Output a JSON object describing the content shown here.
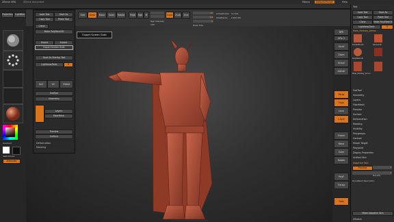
{
  "titlebar": {
    "app": "ZBrush 4R8",
    "document": "ZBrush document",
    "items": [
      "Menus",
      "DefaultZScript",
      "Help"
    ]
  },
  "menubar": [
    "Alpha",
    "Brush",
    "Color",
    "Document",
    "Draw",
    "Edit",
    "File",
    "Layer",
    "Light",
    "Macro",
    "Marker",
    "Material",
    "Movie",
    "Picker",
    "Preferences",
    "Render",
    "Stencil",
    "Stroke",
    "Texture",
    "Tool",
    "Transform",
    "Zplugin",
    "Zscript"
  ],
  "topshelf": {
    "edit_label": "Edit",
    "draw_label": "Draw",
    "move_label": "Move",
    "scale_label": "Scale",
    "rotate_label": "Rotate",
    "mrgb_label": "Mrgb",
    "rgb_label": "Rgb",
    "m_label": "M",
    "zadd_label": "Zadd",
    "zsub_label": "Zsub",
    "zcut_label": "Zcut",
    "focal_label": "Focal Shift",
    "focal_value": "0",
    "draw_size_label": "Draw Size",
    "draw_size_value": "64",
    "zintensity_label": "Z Intensity",
    "zintensity_value": "25",
    "rgb_intensity_label": "Rgb Intensity",
    "rgb_intensity_value": "100",
    "active_points_label": "ActivePoints:",
    "active_points_value": "11,514",
    "total_points_label": "TotalPoints:",
    "total_points_value": "2.607 Mil"
  },
  "leftshelf": {
    "projection_label": "Projection Master",
    "lightbox_label": "LightBox",
    "switch_label": "SwitchColor",
    "gradient_label": "Gradient",
    "alternate_label": "Alternate"
  },
  "palette": {
    "load_tool": "Load Tool",
    "save_as": "Save As",
    "copy_tool": "Copy Tool",
    "paste_tool": "Paste Tool",
    "import": "Import",
    "export": "Export",
    "goz": "GoZ",
    "all": "All",
    "visible": "Visible",
    "lightbox_tools": "Lightbox▸Tools",
    "export_screen_grab": "Export Screen Grab",
    "save_startup": "Save As Startup Tool",
    "item_label": "SubTool",
    "geometry": "Geometry",
    "layers": "Layers",
    "fibermesh": "FiberMesh",
    "preview": "Preview",
    "surface": "Surface",
    "deformation": "Deformation",
    "masking": "Masking",
    "visibility": "Visibility",
    "polygroups": "Polygroups",
    "contact": "Contact",
    "morph_target": "Morph Target",
    "initialize": "Initialize",
    "import_mesh": "Import",
    "clone": "Clone",
    "make_polymesh": "Make PolyMesh3D",
    "goz_all": "GoZ",
    "r_label": "R"
  },
  "tooltip": "Export Screen Grab",
  "rightshelf_items": [
    "BPR",
    "SPix 3",
    "Scroll",
    "Zoom",
    "Actual",
    "AAHalf",
    "Persp",
    "Floor",
    "Local",
    "L.Sym",
    "Frame",
    "Move",
    "Scale",
    "Rotate",
    "PolyF",
    "Transp",
    "Solo"
  ],
  "rightpanel": {
    "header": "Tool",
    "load": "Load Tool",
    "save": "Save As",
    "copy": "Copy Tool",
    "paste": "Paste Tool",
    "import": "Import",
    "export": "Export",
    "clone": "Clone",
    "make_polymesh": "Make PolyMesh3D",
    "goz": "GoZ",
    "all": "All",
    "visible": "Visible",
    "r": "R",
    "lightbox_tools": "Lightbox▸Tools",
    "tool_name": "Male_Fantasy_Armor",
    "thumbs": [
      "SimpleBrush",
      "Sphere3D",
      "PolyMesh3D",
      "Male_Fantasy_Armor"
    ],
    "sections": [
      "SubTool",
      "Geometry",
      "Layers",
      "FiberMesh",
      "Preview",
      "Surface",
      "Deformation",
      "Masking",
      "Visibility",
      "Polygroups",
      "Contact",
      "Morph Target",
      "Polypaint",
      "UV Map",
      "Texture Map",
      "Displacement Map",
      "Normal Map",
      "Vector Displacement Map",
      "Display Properties",
      "Unified Skin"
    ],
    "adaptive_label": "Adaptive Skin",
    "preview_btn": "Preview",
    "density_label": "Density",
    "density_value": "2",
    "dynamesh_label": "DynaMesh Resolution",
    "dynamesh_value": "0",
    "make_adaptive": "Make Adaptive Skin",
    "zsketch": "ZSketch"
  },
  "colors": {
    "accent": "#d9731c",
    "figure": "#b8553a"
  }
}
